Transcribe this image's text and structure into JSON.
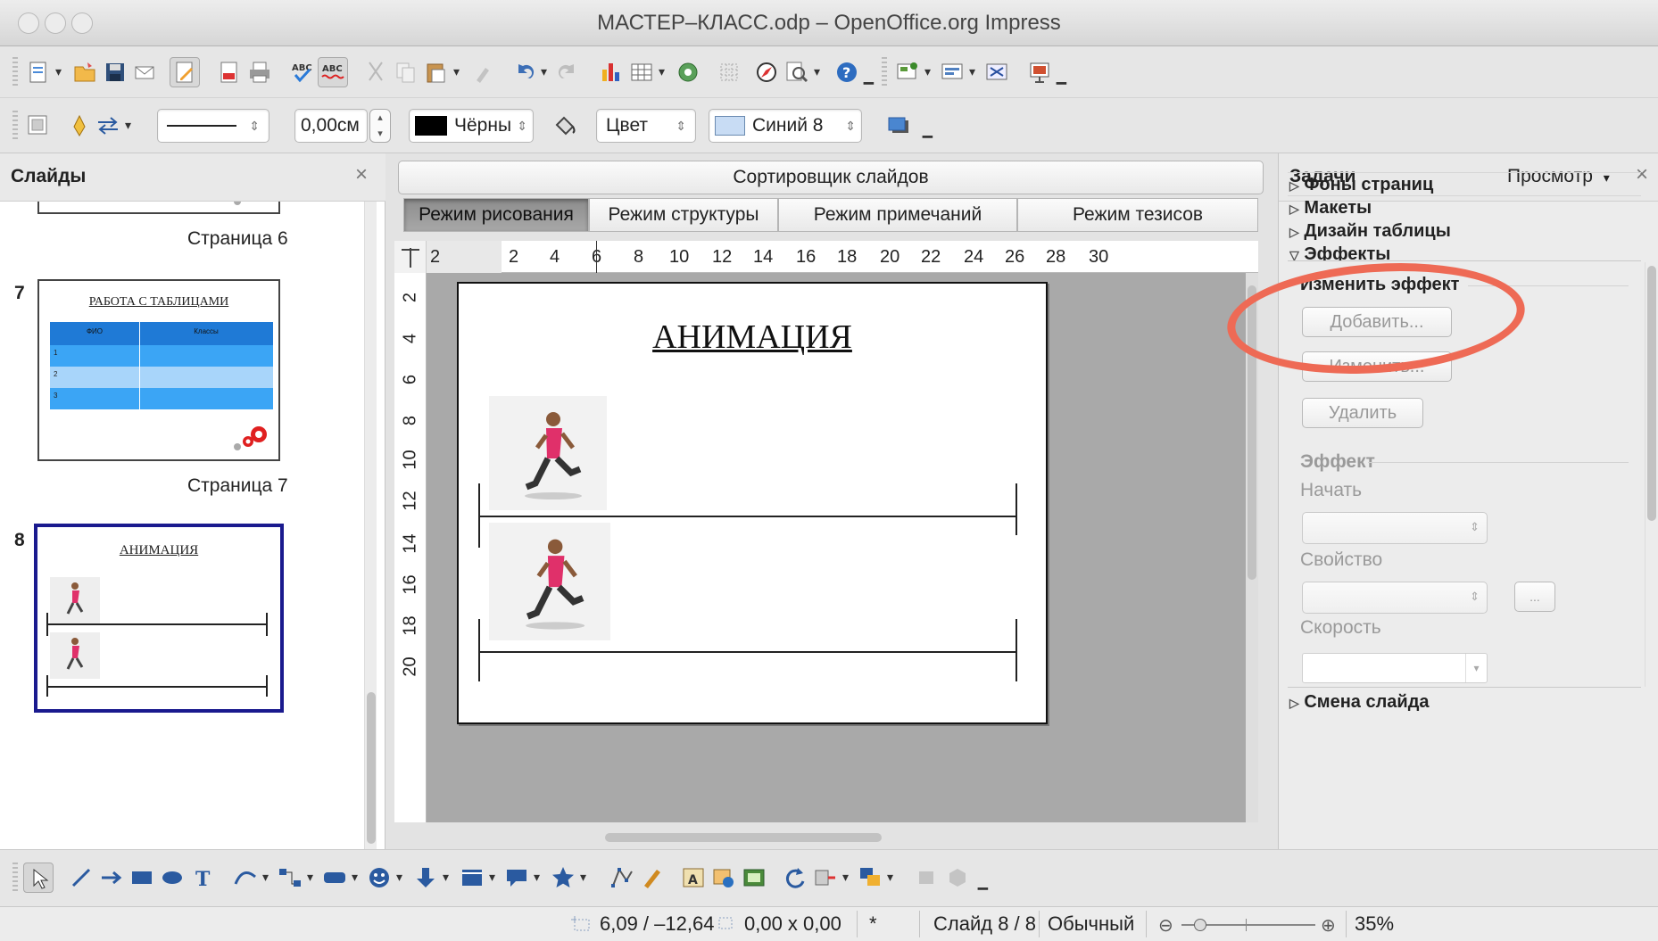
{
  "window": {
    "title": "МАСТЕР–КЛАСС.odp – OpenOffice.org Impress"
  },
  "line_toolbar": {
    "width_value": "0,00см",
    "line_color": "Чёрны",
    "area_style": "Цвет",
    "area_color": "Синий 8"
  },
  "slides_panel": {
    "title": "Слайды",
    "slides": [
      {
        "caption": "Страница 6"
      },
      {
        "number": "7",
        "heading": "РАБОТА С ТАБЛИЦАМИ",
        "table_headers": [
          "ФИО",
          "Классы"
        ],
        "row_numbers": [
          "1",
          "2",
          "3"
        ],
        "caption": "Страница 7"
      },
      {
        "number": "8",
        "heading": "АНИМАЦИЯ"
      }
    ]
  },
  "view_tabs": {
    "sorter": "Сортировщик слайдов",
    "tabs": [
      "Режим рисования",
      "Режим структуры",
      "Режим примечаний",
      "Режим тезисов"
    ]
  },
  "ruler_h": [
    "2",
    "2",
    "4",
    "6",
    "8",
    "10",
    "12",
    "14",
    "16",
    "18",
    "20",
    "22",
    "24",
    "26",
    "28",
    "30"
  ],
  "ruler_v": [
    "2",
    "4",
    "6",
    "8",
    "10",
    "12",
    "14",
    "16",
    "18",
    "20"
  ],
  "slide": {
    "title": "АНИМАЦИЯ"
  },
  "tasks": {
    "title": "Задачи",
    "view_menu": "Просмотр",
    "sections": [
      "Фоны страниц",
      "Макеты",
      "Дизайн таблицы",
      "Эффекты"
    ],
    "change_effect": "Изменить эффект",
    "add_button": "Добавить...",
    "modify_button": "Изменить...",
    "remove_button": "Удалить",
    "effect_label": "Эффект",
    "start_label": "Начать",
    "property_label": "Свойство",
    "property_more": "...",
    "speed_label": "Скорость",
    "transition_section": "Смена слайда"
  },
  "status": {
    "position": "6,09 / –12,64",
    "size": "0,00 x 0,00",
    "modified": "*",
    "slide": "Слайд 8 / 8",
    "layout": "Обычный",
    "zoom": "35%"
  },
  "colors": {
    "annotation": "#ee6a55",
    "selected_slide": "#1a1a8e",
    "table_blue": "#2d96e6"
  }
}
